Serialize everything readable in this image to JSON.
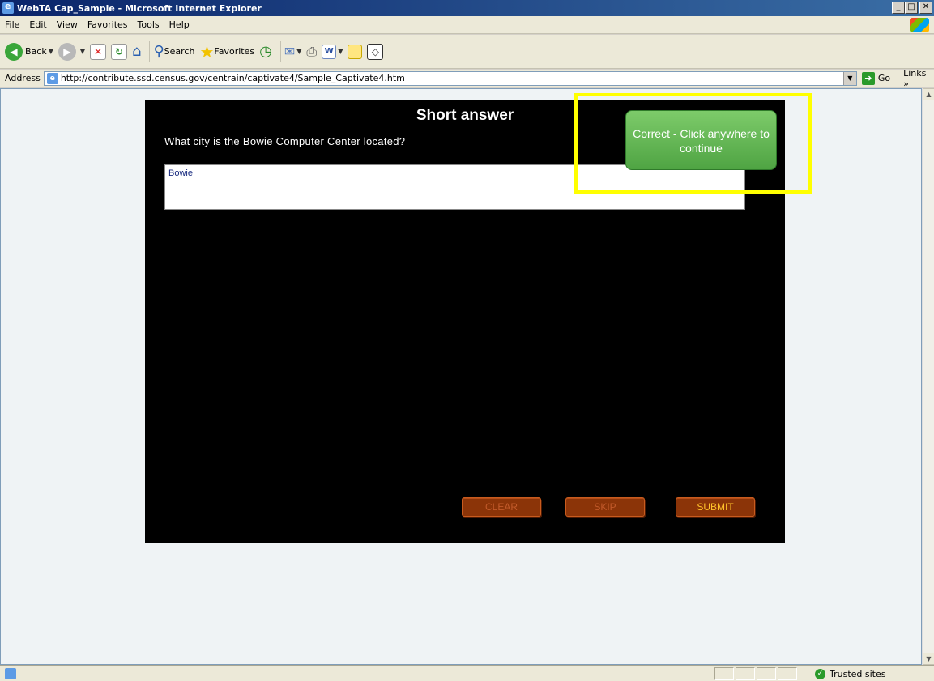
{
  "window": {
    "title": "WebTA Cap_Sample - Microsoft Internet Explorer",
    "min": "_",
    "max": "□",
    "close": "✕"
  },
  "menu": [
    "File",
    "Edit",
    "View",
    "Favorites",
    "Tools",
    "Help"
  ],
  "toolbar": {
    "back_label": "Back",
    "search_label": "Search",
    "favorites_label": "Favorites",
    "word_glyph": "W"
  },
  "address": {
    "label": "Address",
    "url": "http://contribute.ssd.census.gov/centrain/captivate4/Sample_Captivate4.htm",
    "go_label": "Go",
    "links_label": "Links »"
  },
  "quiz": {
    "title": "Short answer",
    "question": "What city is the Bowie Computer Center located?",
    "answer": "Bowie",
    "buttons": {
      "clear": "CLEAR",
      "skip": "SKIP",
      "submit": "SUBMIT"
    },
    "feedback": "Correct - Click anywhere to continue",
    "colors": {
      "stage": "#000000",
      "feedback": "#5fb250",
      "highlight": "#ffff00",
      "button": "#8b3408"
    }
  },
  "status": {
    "zone": "Trusted sites"
  }
}
